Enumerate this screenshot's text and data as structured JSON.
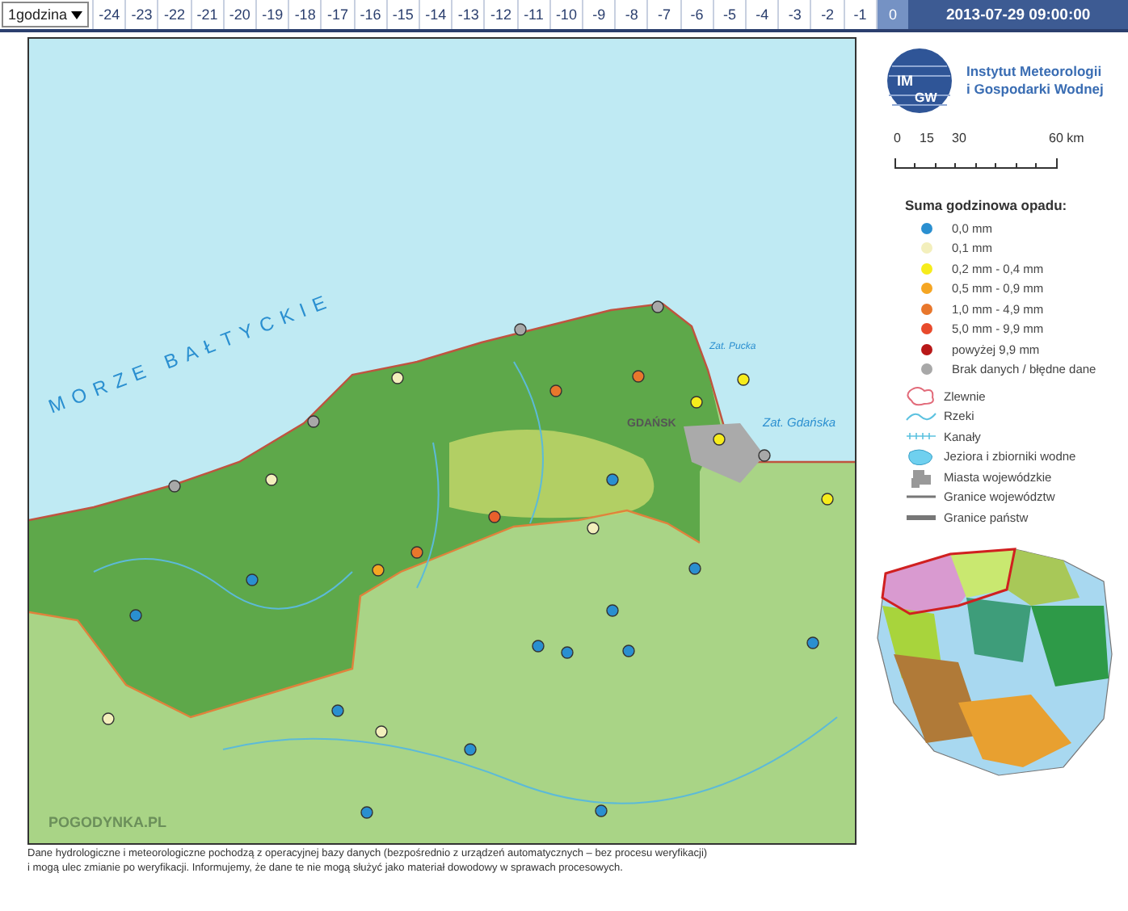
{
  "toolbar": {
    "interval": "1godzina",
    "hours": [
      {
        "label": "-24",
        "selected": false
      },
      {
        "label": "-23",
        "selected": false
      },
      {
        "label": "-22",
        "selected": false
      },
      {
        "label": "-21",
        "selected": false
      },
      {
        "label": "-20",
        "selected": false
      },
      {
        "label": "-19",
        "selected": false
      },
      {
        "label": "-18",
        "selected": false
      },
      {
        "label": "-17",
        "selected": false
      },
      {
        "label": "-16",
        "selected": false
      },
      {
        "label": "-15",
        "selected": false
      },
      {
        "label": "-14",
        "selected": false
      },
      {
        "label": "-13",
        "selected": false
      },
      {
        "label": "-12",
        "selected": false
      },
      {
        "label": "-11",
        "selected": false
      },
      {
        "label": "-10",
        "selected": false
      },
      {
        "label": "-9",
        "selected": false
      },
      {
        "label": "-8",
        "selected": false
      },
      {
        "label": "-7",
        "selected": false
      },
      {
        "label": "-6",
        "selected": false
      },
      {
        "label": "-5",
        "selected": false
      },
      {
        "label": "-4",
        "selected": false
      },
      {
        "label": "-3",
        "selected": false
      },
      {
        "label": "-2",
        "selected": false
      },
      {
        "label": "-1",
        "selected": false
      },
      {
        "label": "0",
        "selected": true
      }
    ],
    "datetime": "2013-07-29 09:00:00"
  },
  "map": {
    "sea_label": "MORZE BAŁTYCKIE",
    "city_label": "GDAŃSK",
    "bay_label": "Zat. Gdańska",
    "lagoon_label": "Zat. Pucka",
    "watermark": "POGODYNKA.PL",
    "stations": [
      {
        "color": "#a8a8a8"
      },
      {
        "color": "#a8a8a8"
      },
      {
        "color": "#f3efbc"
      },
      {
        "color": "#a8a8a8"
      },
      {
        "color": "#a8a8a8"
      },
      {
        "color": "#f3efbc"
      },
      {
        "color": "#e8772c"
      },
      {
        "color": "#e8772c"
      },
      {
        "color": "#f6ec1c"
      },
      {
        "color": "#f6ec1c"
      },
      {
        "color": "#f6ec1c"
      },
      {
        "color": "#a8a8a8"
      },
      {
        "color": "#f6ec1c"
      },
      {
        "color": "#2a8fd0"
      },
      {
        "color": "#e8602c"
      },
      {
        "color": "#f3efbc"
      },
      {
        "color": "#f5a623"
      },
      {
        "color": "#e8772c"
      },
      {
        "color": "#2a8fd0"
      },
      {
        "color": "#2a8fd0"
      },
      {
        "color": "#2a8fd0"
      },
      {
        "color": "#2a8fd0"
      },
      {
        "color": "#2a8fd0"
      },
      {
        "color": "#2a8fd0"
      },
      {
        "color": "#2a8fd0"
      },
      {
        "color": "#2a8fd0"
      },
      {
        "color": "#f3efbc"
      },
      {
        "color": "#2a8fd0"
      },
      {
        "color": "#f3efbc"
      },
      {
        "color": "#2a8fd0"
      },
      {
        "color": "#2a8fd0"
      },
      {
        "color": "#2a8fd0"
      }
    ]
  },
  "institute": {
    "logo_top": "IM",
    "logo_bottom": "GW",
    "name_lines": [
      "Instytut Meteorologii",
      "i Gospodarki Wodnej"
    ]
  },
  "scale": {
    "ticks": [
      "0",
      "15",
      "30",
      "60 km"
    ]
  },
  "legend": {
    "title": "Suma godzinowa opadu:",
    "classes": [
      {
        "label": "0,0 mm",
        "color": "#2a8fd0"
      },
      {
        "label": "0,1 mm",
        "color": "#f3efbc"
      },
      {
        "label": "0,2 mm - 0,4 mm",
        "color": "#f6ec1c"
      },
      {
        "label": "0,5 mm - 0,9 mm",
        "color": "#f5a623"
      },
      {
        "label": "1,0 mm - 4,9 mm",
        "color": "#e8772c"
      },
      {
        "label": "5,0 mm - 9,9 mm",
        "color": "#e84a2c"
      },
      {
        "label": "powyżej 9,9 mm",
        "color": "#b81818"
      },
      {
        "label": "Brak danych / błędne dane",
        "color": "#a8a8a8"
      }
    ],
    "layers": [
      {
        "kind": "catchment",
        "label": "Zlewnie"
      },
      {
        "kind": "river",
        "label": "Rzeki"
      },
      {
        "kind": "canal",
        "label": "Kanały"
      },
      {
        "kind": "lake",
        "label": "Jeziora i zbiorniki wodne"
      },
      {
        "kind": "city",
        "label": "Miasta wojewódzkie"
      },
      {
        "kind": "province",
        "label": "Granice województw"
      },
      {
        "kind": "country",
        "label": "Granice państw"
      }
    ]
  },
  "disclaimer": [
    "Dane hydrologiczne i meteorologiczne pochodzą z operacyjnej bazy danych (bezpośrednio z urządzeń automatycznych – bez procesu weryfikacji)",
    "i mogą ulec zmianie po weryfikacji. Informujemy, że dane te nie mogą służyć jako materiał dowodowy w sprawach procesowych."
  ]
}
